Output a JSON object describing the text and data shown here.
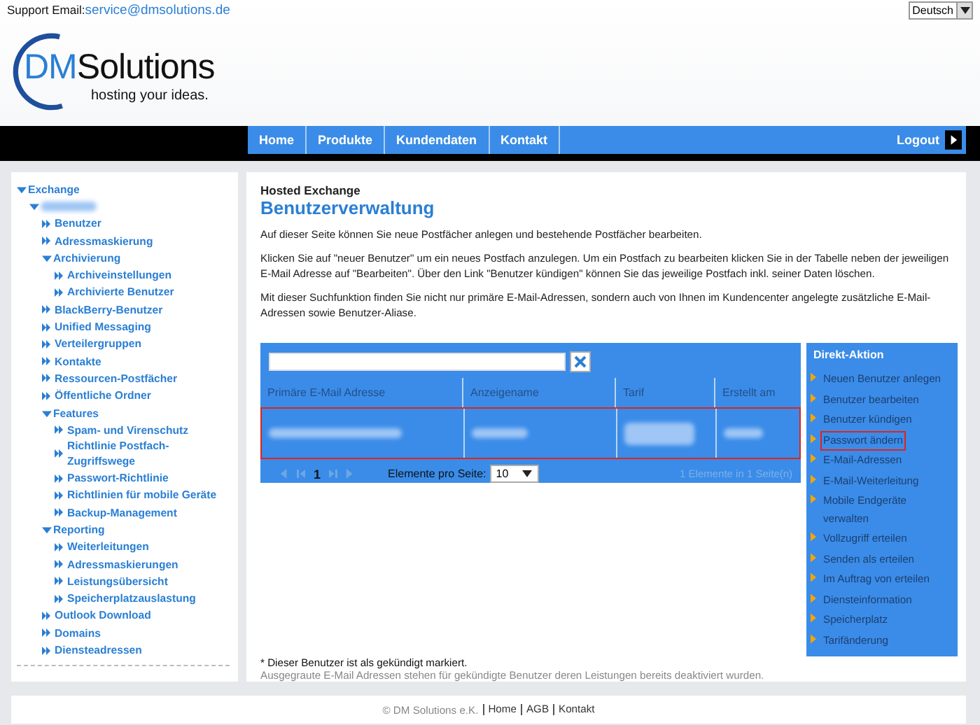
{
  "top_bar": {
    "support_label": "Support Email:",
    "support_email": "service@dmsolutions.de",
    "language": "Deutsch"
  },
  "logo": {
    "name_part_1": "DM",
    "name_part_2": "Solutions",
    "tagline": "hosting your ideas."
  },
  "nav": {
    "items": [
      {
        "label": "Home"
      },
      {
        "label": "Produkte"
      },
      {
        "label": "Kundendaten"
      },
      {
        "label": "Kontakt"
      }
    ],
    "logout": "Logout"
  },
  "sidebar": {
    "items": [
      {
        "label": "Exchange",
        "expanded": true,
        "children": [
          {
            "kind": "redacted",
            "expanded": true,
            "children": [
              {
                "label": "Benutzer"
              },
              {
                "label": "Adressmaskierung"
              },
              {
                "label": "Archivierung",
                "expanded": true,
                "children": [
                  {
                    "label": "Archiveinstellungen"
                  },
                  {
                    "label": "Archivierte Benutzer"
                  }
                ]
              },
              {
                "label": "BlackBerry-Benutzer"
              },
              {
                "label": "Unified Messaging"
              },
              {
                "label": "Verteilergruppen"
              },
              {
                "label": "Kontakte"
              },
              {
                "label": "Ressourcen-Postfächer"
              },
              {
                "label": "Öffentliche Ordner"
              },
              {
                "label": "Features",
                "expanded": true,
                "children": [
                  {
                    "label": "Spam- und Virenschutz"
                  },
                  {
                    "label": "Richtlinie Postfach-Zugriffswege"
                  },
                  {
                    "label": "Passwort-Richtlinie"
                  },
                  {
                    "label": "Richtlinien für mobile Geräte"
                  },
                  {
                    "label": "Backup-Management"
                  }
                ]
              },
              {
                "label": "Reporting",
                "expanded": true,
                "children": [
                  {
                    "label": "Weiterleitungen"
                  },
                  {
                    "label": "Adressmaskierungen"
                  },
                  {
                    "label": "Leistungsübersicht"
                  },
                  {
                    "label": "Speicherplatzauslastung"
                  }
                ]
              },
              {
                "label": "Outlook Download"
              },
              {
                "label": "Domains"
              },
              {
                "label": "Diensteadressen"
              }
            ]
          }
        ]
      }
    ]
  },
  "content": {
    "section": "Hosted Exchange",
    "title": "Benutzerverwaltung",
    "paragraphs": [
      "Auf dieser Seite können Sie neue Postfächer anlegen und bestehende Postfächer bearbeiten.",
      "Klicken Sie auf \"neuer Benutzer\" um ein neues Postfach anzulegen. Um ein Postfach zu bearbeiten klicken Sie in der Tabelle neben der jeweiligen E-Mail Adresse auf \"Bearbeiten\". Über den Link \"Benutzer kündigen\" können Sie das jeweilige Postfach inkl. seiner Daten löschen.",
      "Mit dieser Suchfunktion finden Sie nicht nur primäre E-Mail-Adressen, sondern auch von Ihnen im Kundencenter angelegte zusätzliche E-Mail-Adressen sowie Benutzer-Aliase."
    ],
    "table": {
      "columns": [
        "Primäre E-Mail Adresse",
        "Anzeigename",
        "Tarif",
        "Erstellt am"
      ],
      "rows": [
        {
          "kind": "redacted",
          "selected": true
        }
      ],
      "pager": {
        "page": "1",
        "page_size_label": "Elemente pro Seite:",
        "page_size": "10",
        "summary": "1 Elemente in 1 Seite(n)"
      }
    },
    "notes": [
      "* Dieser Benutzer ist als gekündigt markiert.",
      "Ausgegraute E-Mail Adressen stehen für gekündigte Benutzer deren Leistungen bereits deaktiviert wurden."
    ]
  },
  "actions": {
    "title": "Direkt-Aktion",
    "items": [
      {
        "label": "Neuen Benutzer anlegen",
        "selected": false
      },
      {
        "label": "Benutzer bearbeiten",
        "selected": false
      },
      {
        "label": "Benutzer kündigen",
        "selected": false
      },
      {
        "label": "Passwort ändern",
        "selected": true
      },
      {
        "label": "E-Mail-Adressen",
        "selected": false
      },
      {
        "label": "E-Mail-Weiterleitung",
        "selected": false
      },
      {
        "label": "Mobile Endgeräte verwalten",
        "selected": false
      },
      {
        "label": "Vollzugriff erteilen",
        "selected": false
      },
      {
        "label": "Senden als erteilen",
        "selected": false
      },
      {
        "label": "Im Auftrag von erteilen",
        "selected": false
      },
      {
        "label": "Diensteinformation",
        "selected": false
      },
      {
        "label": "Speicherplatz",
        "selected": false
      },
      {
        "label": "Tarifänderung",
        "selected": false
      }
    ]
  },
  "footer": {
    "copyright": "© DM Solutions e.K.",
    "links": [
      "Home",
      "AGB",
      "Kontakt"
    ]
  }
}
